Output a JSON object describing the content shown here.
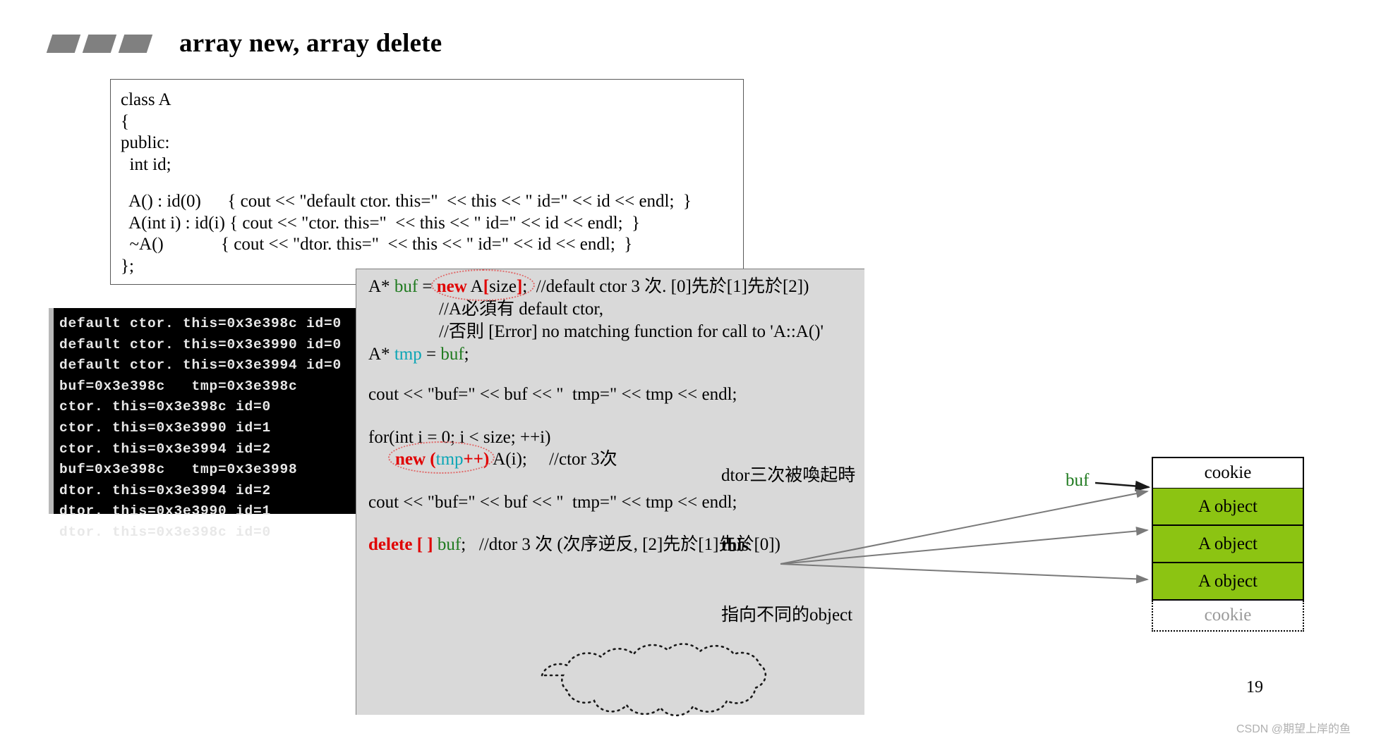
{
  "slide": {
    "title": "array new, array delete",
    "page_number": "19",
    "watermark": "CSDN @期望上岸的鱼"
  },
  "class_code": {
    "lines": [
      "class A",
      "{",
      "public:",
      "  int id;",
      "",
      "  A() : id(0)      { cout << \"default ctor. this=\"  << this << \" id=\" << id << endl;  }",
      "  A(int i) : id(i) { cout << \"ctor. this=\"  << this << \" id=\" << id << endl;  }",
      "  ~A()             { cout << \"dtor. this=\"  << this << \" id=\" << id << endl;  }",
      "};"
    ]
  },
  "terminal": {
    "lines": [
      "default ctor. this=0x3e398c id=0",
      "default ctor. this=0x3e3990 id=0",
      "default ctor. this=0x3e3994 id=0",
      "buf=0x3e398c   tmp=0x3e398c",
      "ctor. this=0x3e398c id=0",
      "ctor. this=0x3e3990 id=1",
      "ctor. this=0x3e3994 id=2",
      "buf=0x3e398c   tmp=0x3e3998",
      "dtor. this=0x3e3994 id=2",
      "dtor. this=0x3e3990 id=1",
      "dtor. this=0x3e398c id=0"
    ]
  },
  "gray_code": {
    "line1_a": "A* ",
    "line1_buf": "buf",
    "line1_eq": " = ",
    "line1_new": "new",
    "line1_A": " A",
    "line1_brk_open": "[",
    "line1_size": "size",
    "line1_brk_close": "]",
    "line1_semi": ";",
    "line1_comment": "  //default ctor 3 次. [0]先於[1]先於[2])",
    "line2_comment": "//A必須有 default ctor,",
    "line3_comment": "//否則 [Error] no matching function for call to 'A::A()'",
    "line4_a": "A* ",
    "line4_tmp": "tmp",
    "line4_eq": " = ",
    "line4_buf": "buf",
    "line4_semi": ";",
    "line5": "cout << \"buf=\" << buf << \"  tmp=\" << tmp << endl;",
    "line6": "for(int i = 0; i < size; ++i)",
    "line7_new": "new (",
    "line7_tmp": "tmp",
    "line7_rest": "++)",
    "line7_call": " A(i);     //ctor 3次",
    "line8": "cout << \"buf=\" << buf << \"  tmp=\" << tmp << endl;",
    "line9_delete": "delete [ ]",
    "line9_buf": " buf",
    "line9_semi": ";",
    "line9_comment": "   //dtor 3 次 (次序逆反, [2]先於[1]先於[0])"
  },
  "annotation": {
    "line1": "dtor三次被喚起時",
    "line2": "this",
    "line3": "指向不同的object"
  },
  "memory": {
    "buf_label": "buf",
    "cells": [
      {
        "label": "cookie",
        "kind": "cookie-top"
      },
      {
        "label": "A object",
        "kind": "object"
      },
      {
        "label": "A object",
        "kind": "object"
      },
      {
        "label": "A object",
        "kind": "object"
      },
      {
        "label": "cookie",
        "kind": "cookie-bottom"
      }
    ]
  },
  "colors": {
    "accent_green": "#1f7a1f",
    "accent_red": "#e00000",
    "object_green": "#8cc412",
    "panel_gray": "#d9d9d9",
    "bullet_gray": "#808080"
  }
}
